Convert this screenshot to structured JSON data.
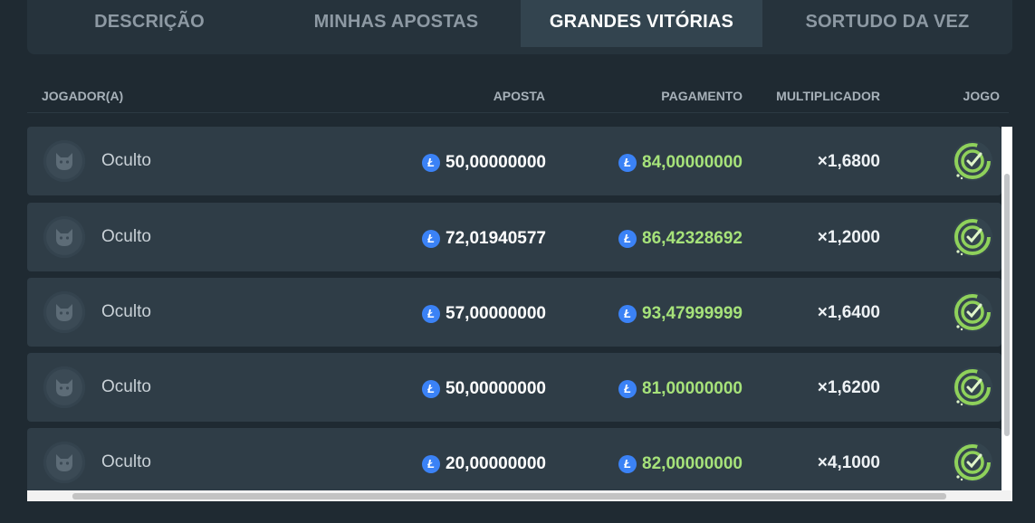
{
  "tabs": [
    {
      "label": "DESCRIÇÃO",
      "active": false
    },
    {
      "label": "MINHAS APOSTAS",
      "active": false
    },
    {
      "label": "GRANDES VITÓRIAS",
      "active": true
    },
    {
      "label": "SORTUDO DA VEZ",
      "active": false
    }
  ],
  "table": {
    "columns": [
      "JOGADOR(A)",
      "APOSTA",
      "PAGAMENTO",
      "MULTIPLICADOR",
      "JOGO"
    ],
    "currency_icon": "litecoin-icon",
    "currency_symbol": "Ł",
    "rows": [
      {
        "player": "Oculto",
        "bet": "50,00000000",
        "payout": "84,00000000",
        "multiplier": "×1,6800",
        "game_icon": "limbo-target-icon"
      },
      {
        "player": "Oculto",
        "bet": "72,01940577",
        "payout": "86,42328692",
        "multiplier": "×1,2000",
        "game_icon": "limbo-target-icon"
      },
      {
        "player": "Oculto",
        "bet": "57,00000000",
        "payout": "93,47999999",
        "multiplier": "×1,6400",
        "game_icon": "limbo-target-icon"
      },
      {
        "player": "Oculto",
        "bet": "50,00000000",
        "payout": "81,00000000",
        "multiplier": "×1,6200",
        "game_icon": "limbo-target-icon"
      },
      {
        "player": "Oculto",
        "bet": "20,00000000",
        "payout": "82,00000000",
        "multiplier": "×4,1000",
        "game_icon": "limbo-target-icon"
      }
    ]
  },
  "colors": {
    "background": "#1f2a32",
    "payout_green": "#a6e27a",
    "currency_blue": "#3b82f6",
    "active_tab": "#33444f"
  }
}
